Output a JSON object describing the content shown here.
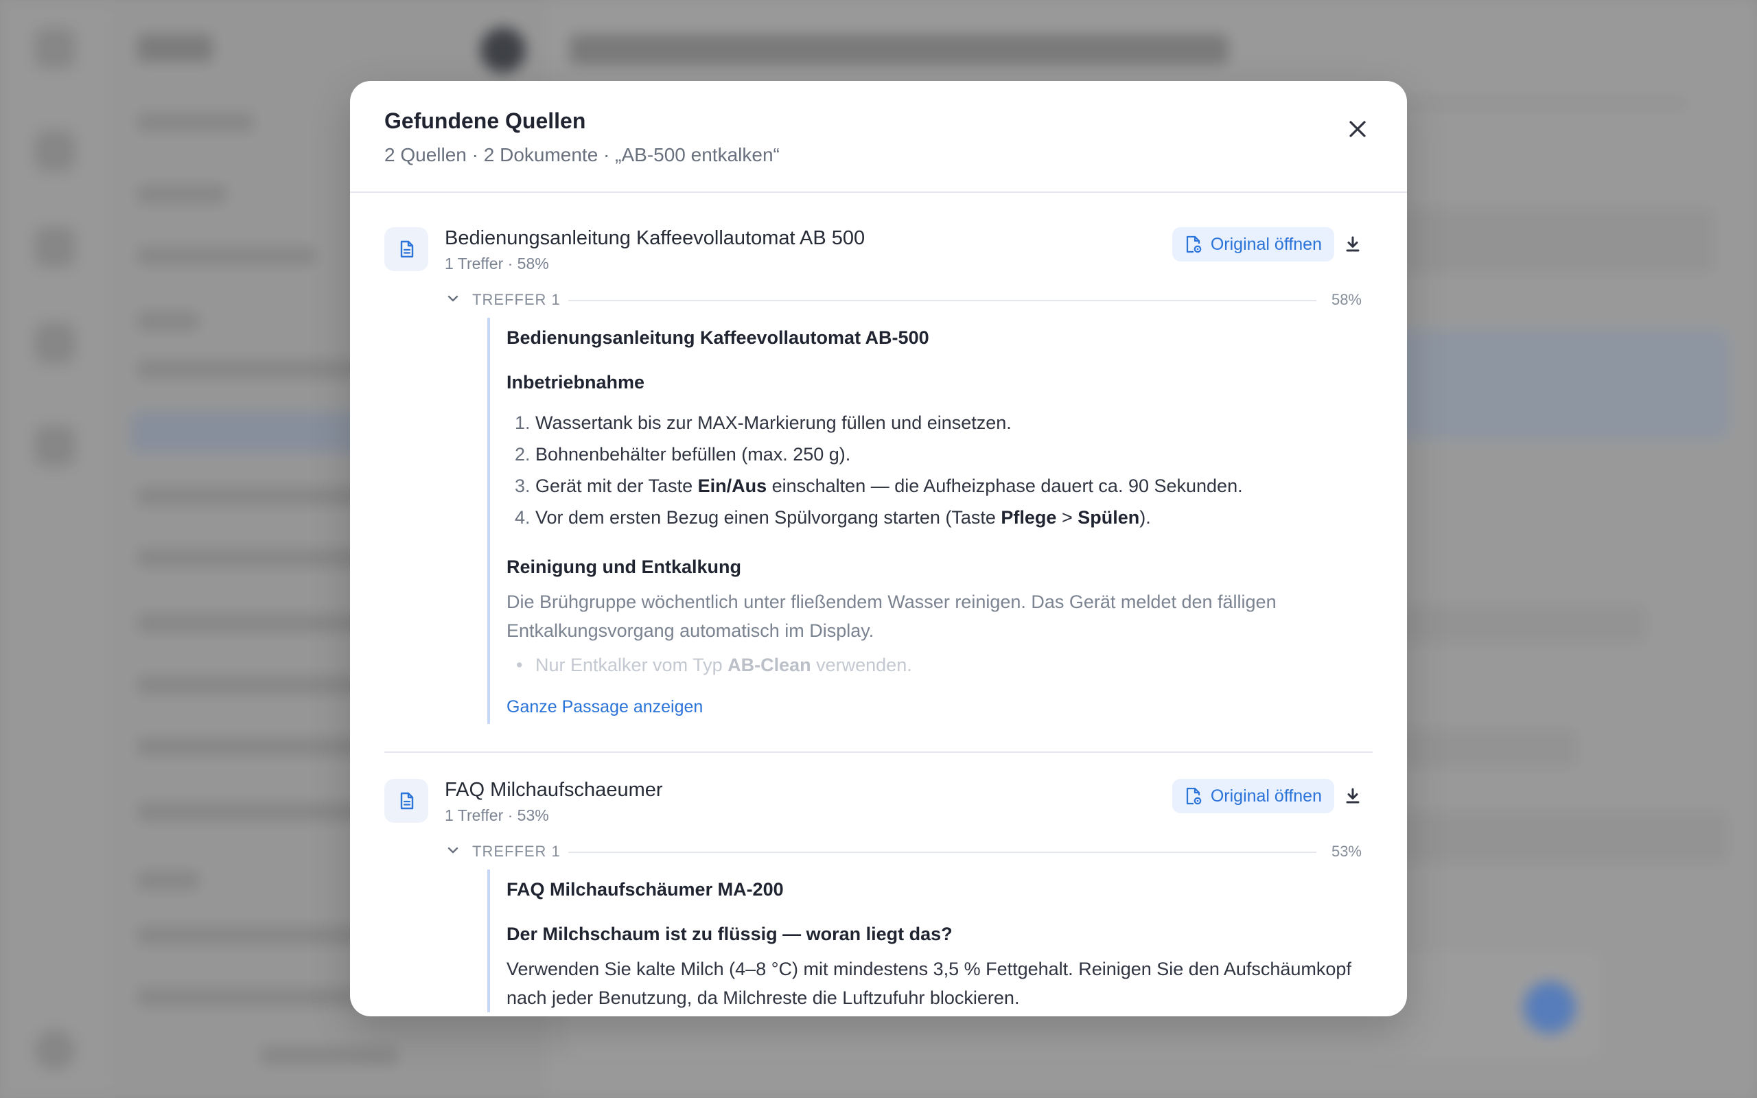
{
  "modal": {
    "title": "Gefundene Quellen",
    "subtitle": "2 Quellen · 2 Dokumente · „AB-500 entkalken“",
    "close_icon": "close-icon"
  },
  "sources": [
    {
      "title": "Bedienungsanleitung Kaffeevollautomat AB 500",
      "meta": "1 Treffer · 58%",
      "open_label": "Original öffnen",
      "hit": {
        "label": "TREFFER 1",
        "score": "58%",
        "heading": "Bedienungsanleitung Kaffeevollautomat AB-500",
        "section1": "Inbetriebnahme",
        "steps": [
          {
            "n": "1.",
            "pre": "Wassertank bis zur MAX-Markierung füllen und einsetzen."
          },
          {
            "n": "2.",
            "pre": "Bohnenbehälter befüllen (max. 250 g)."
          },
          {
            "n": "3.",
            "pre": "Gerät mit der Taste ",
            "b1": "Ein/Aus",
            "post": " einschalten — die Aufheizphase dauert ca. 90 Sekunden."
          },
          {
            "n": "4.",
            "pre": "Vor dem ersten Bezug einen Spülvorgang starten (Taste ",
            "b1": "Pflege",
            "mid": " > ",
            "b2": "Spülen",
            "post": ")."
          }
        ],
        "section2": "Reinigung und Entkalkung",
        "paragraph": "Die Brühgruppe wöchentlich unter fließendem Wasser reinigen. Das Gerät meldet den fälligen Entkalkungsvorgang automatisch im Display.",
        "fade_pre": "Nur Entkalker vom Typ ",
        "fade_bold": "AB-Clean",
        "fade_post": " verwenden.",
        "show_more": "Ganze Passage anzeigen"
      }
    },
    {
      "title": "FAQ Milchaufschaeumer",
      "meta": "1 Treffer · 53%",
      "open_label": "Original öffnen",
      "hit": {
        "label": "TREFFER 1",
        "score": "53%",
        "heading": "FAQ Milchaufschäumer MA-200",
        "question": "Der Milchschaum ist zu flüssig — woran liegt das?",
        "answer": "Verwenden Sie kalte Milch (4–8 °C) mit mindestens 3,5 % Fettgehalt. Reinigen Sie den Aufschäumkopf nach jeder Benutzung, da Milchreste die Luftzufuhr blockieren."
      }
    }
  ],
  "colors": {
    "accent": "#2a73d8",
    "accent_bg": "#e8f1fd",
    "passage_rule": "#c5d9f6"
  }
}
